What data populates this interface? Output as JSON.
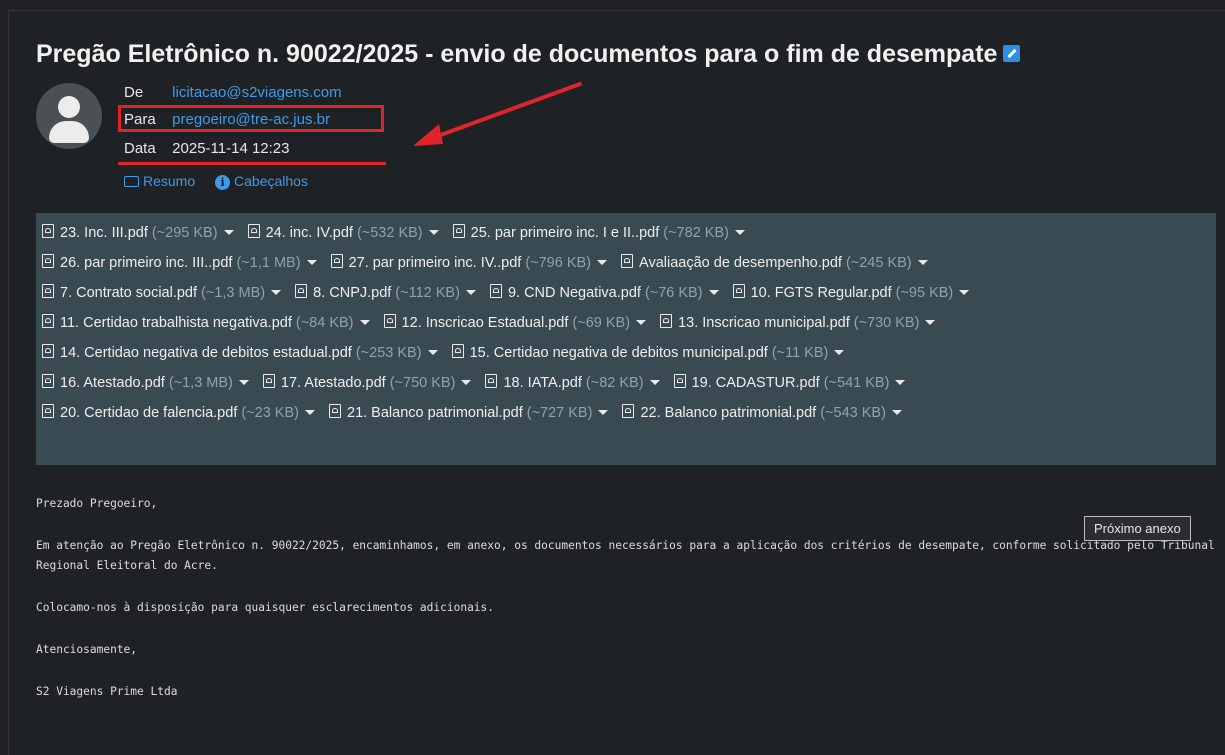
{
  "subject": "Pregão Eletrônico n. 90022/2025 - envio de documentos para o fim de desempate",
  "header": {
    "from_label": "De",
    "from_value": "licitacao@s2viagens.com",
    "to_label": "Para",
    "to_value": "pregoeiro@tre-ac.jus.br",
    "date_label": "Data",
    "date_value": "2025-11-14 12:23",
    "summary_link": "Resumo",
    "headers_link": "Cabeçalhos"
  },
  "attachments": [
    {
      "name": "23. Inc. III.pdf",
      "size": "(~295 KB)"
    },
    {
      "name": "24. inc. IV.pdf",
      "size": "(~532 KB)"
    },
    {
      "name": "25. par primeiro inc. I e II..pdf",
      "size": "(~782 KB)"
    },
    {
      "name": "26. par primeiro inc. III..pdf",
      "size": "(~1,1 MB)"
    },
    {
      "name": "27. par primeiro inc. IV..pdf",
      "size": "(~796 KB)"
    },
    {
      "name": "Avaliaação de desempenho.pdf",
      "size": "(~245 KB)"
    },
    {
      "name": "7. Contrato social.pdf",
      "size": "(~1,3 MB)"
    },
    {
      "name": "8. CNPJ.pdf",
      "size": "(~112 KB)"
    },
    {
      "name": "9. CND Negativa.pdf",
      "size": "(~76 KB)"
    },
    {
      "name": "10. FGTS Regular.pdf",
      "size": "(~95 KB)"
    },
    {
      "name": "11. Certidao trabalhista negativa.pdf",
      "size": "(~84 KB)"
    },
    {
      "name": "12. Inscricao Estadual.pdf",
      "size": "(~69 KB)"
    },
    {
      "name": "13. Inscricao municipal.pdf",
      "size": "(~730 KB)"
    },
    {
      "name": "14. Certidao negativa de debitos estadual.pdf",
      "size": "(~253 KB)"
    },
    {
      "name": "15. Certidao negativa de debitos municipal.pdf",
      "size": "(~11 KB)"
    },
    {
      "name": "16. Atestado.pdf",
      "size": "(~1,3 MB)"
    },
    {
      "name": "17. Atestado.pdf",
      "size": "(~750 KB)"
    },
    {
      "name": "18. IATA.pdf",
      "size": "(~82 KB)"
    },
    {
      "name": "19. CADASTUR.pdf",
      "size": "(~541 KB)"
    },
    {
      "name": "20. Certidao de falencia.pdf",
      "size": "(~23 KB)"
    },
    {
      "name": "21. Balanco patrimonial.pdf",
      "size": "(~727 KB)"
    },
    {
      "name": "22. Balanco patrimonial.pdf",
      "size": "(~543 KB)"
    }
  ],
  "body": {
    "greeting": "Prezado Pregoeiro,",
    "paragraph1": "Em atenção ao Pregão Eletrônico n. 90022/2025, encaminhamos, em anexo, os documentos necessários para a aplicação dos critérios de desempate, conforme solicitado pelo Tribunal Regional Eleitoral do Acre.",
    "paragraph2": "Colocamo-nos à disposição para quaisquer esclarecimentos adicionais.",
    "closing": "Atenciosamente,",
    "signature": "S2 Viagens Prime Ltda"
  },
  "tooltip": "Próximo anexo",
  "colors": {
    "background": "#1f2225",
    "link": "#3d9be9",
    "attachment_panel": "#3a4a52",
    "highlight": "#e0242b"
  }
}
